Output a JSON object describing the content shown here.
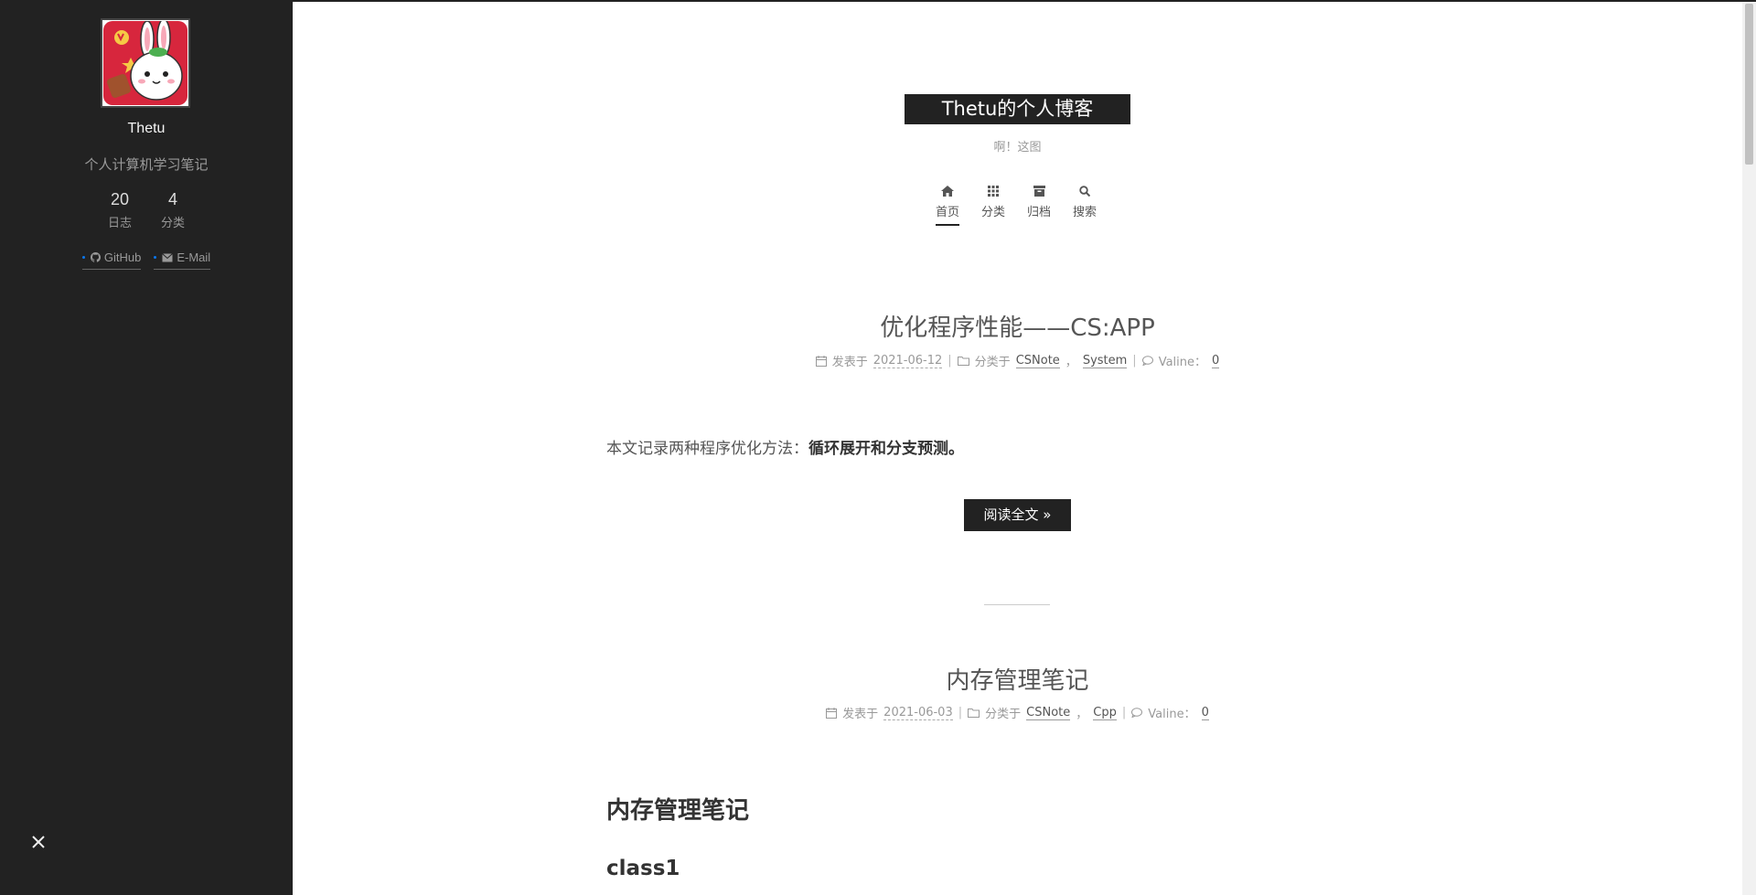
{
  "sidebar": {
    "author_name": "Thetu",
    "author_desc": "个人计算机学习笔记",
    "stats": [
      {
        "count": "20",
        "label": "日志"
      },
      {
        "count": "4",
        "label": "分类"
      }
    ],
    "links": [
      {
        "label": "GitHub",
        "icon": "github-icon"
      },
      {
        "label": "E-Mail",
        "icon": "mail-icon"
      }
    ]
  },
  "header": {
    "brand": "Thetu的个人博客",
    "subtitle": "啊！这图",
    "menu": [
      {
        "label": "首页",
        "icon": "home-icon",
        "active": true
      },
      {
        "label": "分类",
        "icon": "grid-icon",
        "active": false
      },
      {
        "label": "归档",
        "icon": "archive-icon",
        "active": false
      },
      {
        "label": "搜索",
        "icon": "search-icon",
        "active": false
      }
    ]
  },
  "posts": [
    {
      "title": "优化程序性能——CS:APP",
      "meta": {
        "posted_label": "发表于",
        "date": "2021-06-12",
        "category_label": "分类于",
        "categories": [
          "CSNote",
          "System"
        ],
        "comments_label": "Valine：",
        "comments": "0"
      },
      "excerpt_prefix": "本文记录两种程序优化方法：",
      "excerpt_bold": "循环展开和分支预测。",
      "read_more": "阅读全文 »"
    },
    {
      "title": "内存管理笔记",
      "meta": {
        "posted_label": "发表于",
        "date": "2021-06-03",
        "category_label": "分类于",
        "categories": [
          "CSNote",
          "Cpp"
        ],
        "comments_label": "Valine：",
        "comments": "0"
      },
      "heading1": "内存管理笔记",
      "heading2": "class1"
    }
  ],
  "colors": {
    "sidebar_bg": "#222222",
    "accent": "#0a77f0",
    "brand_bg": "#222222"
  }
}
